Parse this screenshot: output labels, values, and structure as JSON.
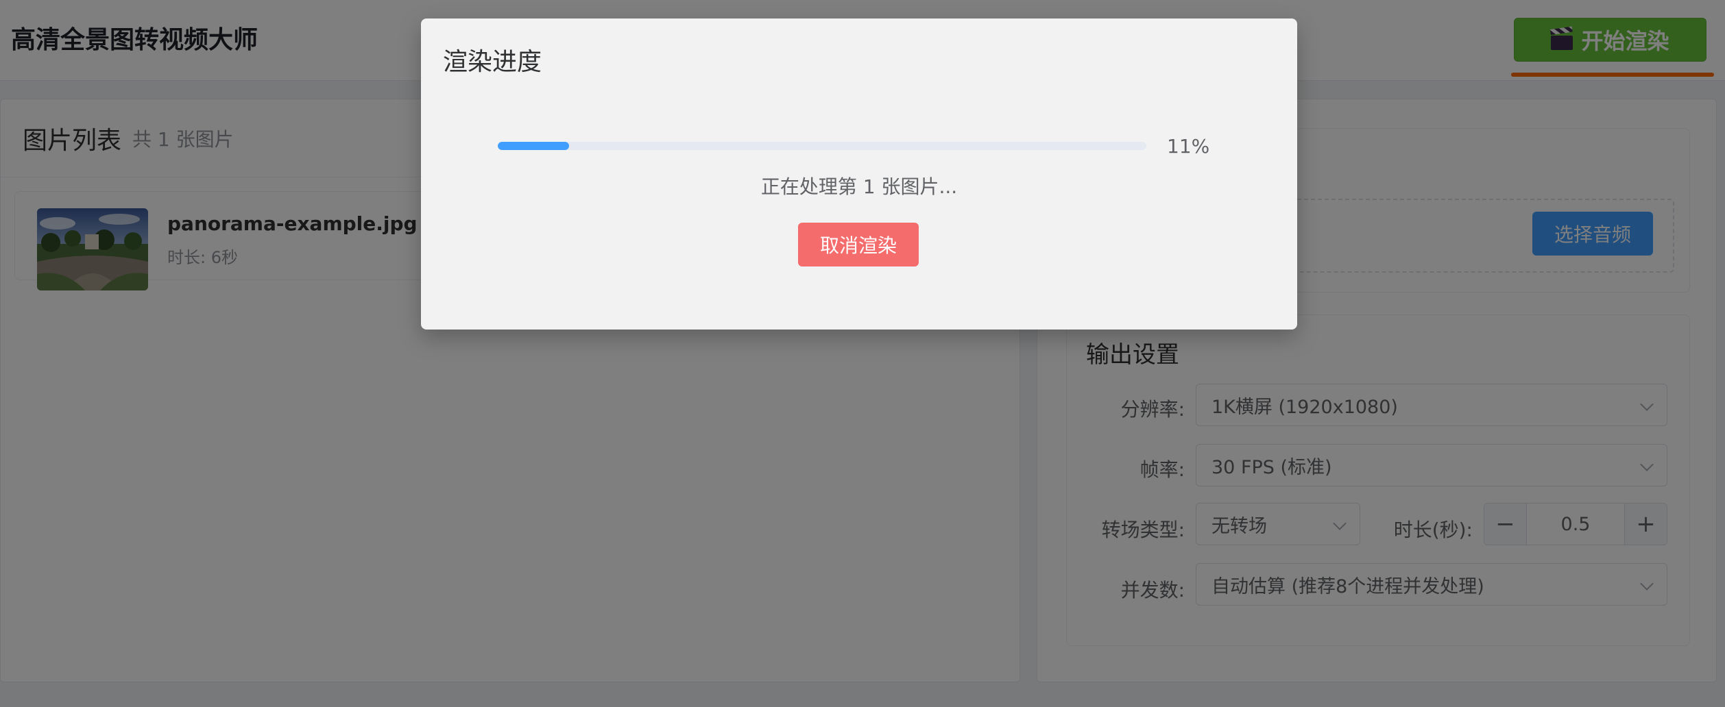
{
  "header": {
    "app_title": "高清全景图转视频大师",
    "start_button_label": "开始渲染"
  },
  "image_list": {
    "title": "图片列表",
    "count_text": "共 1 张图片",
    "items": [
      {
        "name": "panorama-example.jpg",
        "duration": "时长: 6秒"
      }
    ]
  },
  "audio": {
    "select_button_label": "选择音频"
  },
  "output_settings": {
    "title": "输出设置",
    "resolution_label": "分辨率:",
    "resolution_value": "1K横屏 (1920x1080)",
    "fps_label": "帧率:",
    "fps_value": "30 FPS (标准)",
    "transition_label": "转场类型:",
    "transition_value": "无转场",
    "duration_label": "时长(秒):",
    "duration_value": "0.5",
    "concurrency_label": "并发数:",
    "concurrency_value": "自动估算 (推荐8个进程并发处理)"
  },
  "render_dialog": {
    "title": "渲染进度",
    "progress_percent": 11,
    "progress_text": "11%",
    "status_text": "正在处理第 1 张图片...",
    "cancel_label": "取消渲染"
  },
  "colors": {
    "primary": "#409eff",
    "success": "#67c23a",
    "danger": "#f56c6c",
    "accent": "#ff6a00"
  }
}
